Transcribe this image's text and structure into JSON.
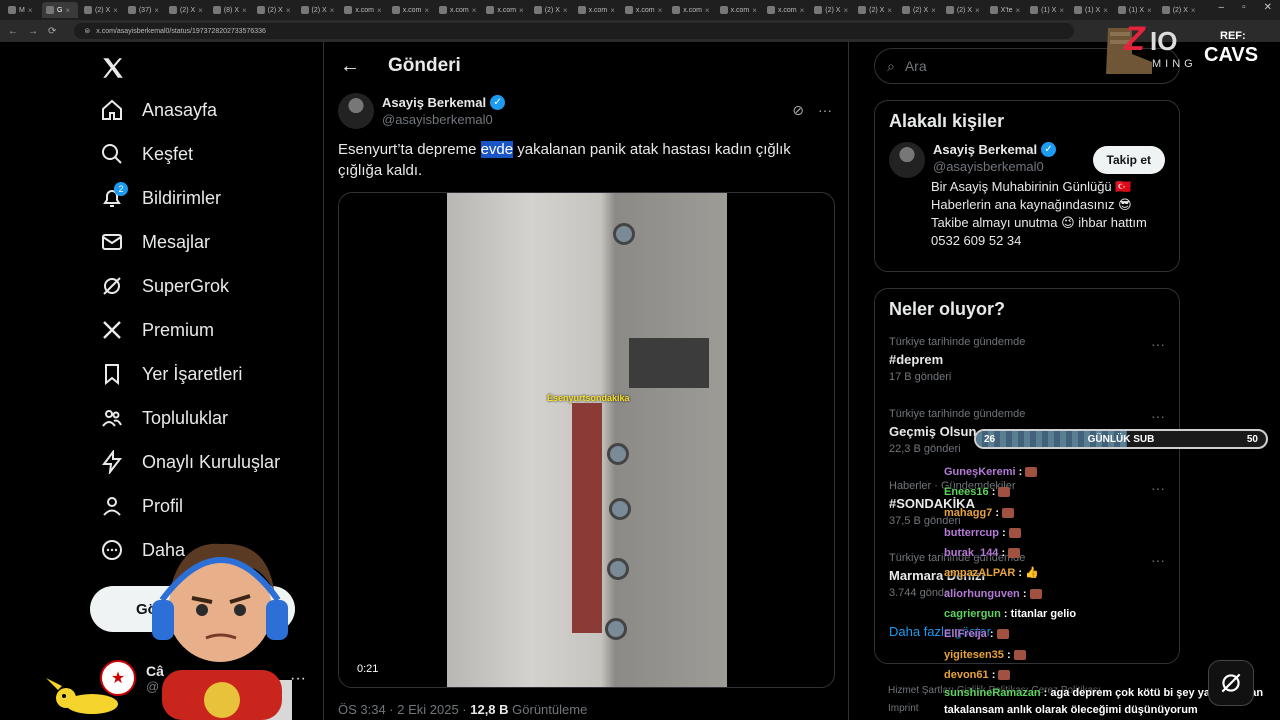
{
  "browser": {
    "tabs": [
      {
        "label": "M",
        "active": false
      },
      {
        "label": "G",
        "active": true
      },
      {
        "label": "(2) X",
        "active": false
      },
      {
        "label": "(37)",
        "active": false
      },
      {
        "label": "(2) X",
        "active": false
      },
      {
        "label": "(8) X",
        "active": false
      },
      {
        "label": "(2) X",
        "active": false
      },
      {
        "label": "(2) X",
        "active": false
      },
      {
        "label": "x.com",
        "active": false
      },
      {
        "label": "x.com",
        "active": false
      },
      {
        "label": "x.com",
        "active": false
      },
      {
        "label": "x.com",
        "active": false
      },
      {
        "label": "(2) X",
        "active": false
      },
      {
        "label": "x.com",
        "active": false
      },
      {
        "label": "x.com",
        "active": false
      },
      {
        "label": "x.com",
        "active": false
      },
      {
        "label": "x.com",
        "active": false
      },
      {
        "label": "x.com",
        "active": false
      },
      {
        "label": "(2) X",
        "active": false
      },
      {
        "label": "(2) X",
        "active": false
      },
      {
        "label": "(2) X",
        "active": false
      },
      {
        "label": "(2) X",
        "active": false
      },
      {
        "label": "X'te",
        "active": false
      },
      {
        "label": "(1) X",
        "active": false
      },
      {
        "label": "(1) X",
        "active": false
      },
      {
        "label": "(1) X",
        "active": false
      },
      {
        "label": "(2) X",
        "active": false
      }
    ],
    "url": "x.com/asayisberkemal0/status/1973728202733576336"
  },
  "sidebar": {
    "items": [
      {
        "label": "Anasayfa",
        "icon": "home-icon"
      },
      {
        "label": "Keşfet",
        "icon": "search-icon"
      },
      {
        "label": "Bildirimler",
        "icon": "bell-icon",
        "badge": "2"
      },
      {
        "label": "Mesajlar",
        "icon": "mail-icon"
      },
      {
        "label": "SuperGrok",
        "icon": "grok-icon"
      },
      {
        "label": "Premium",
        "icon": "x-logo-icon"
      },
      {
        "label": "Yer İşaretleri",
        "icon": "bookmark-icon"
      },
      {
        "label": "Topluluklar",
        "icon": "communities-icon"
      },
      {
        "label": "Onaylı Kuruluşlar",
        "icon": "lightning-icon"
      },
      {
        "label": "Profil",
        "icon": "person-icon"
      },
      {
        "label": "Daha",
        "icon": "more-circle-icon"
      }
    ],
    "post_button": "Gö",
    "account_name": "Câ",
    "account_handle": "@"
  },
  "main": {
    "header_title": "Gönderi",
    "tweet": {
      "author_name": "Asayiş Berkemal",
      "author_handle": "@asayisberkemal0",
      "text_before": "Esenyurt’ta depreme ",
      "text_highlight": "evde",
      "text_after": " yakalanan panik atak hastası kadın çığlık çığlığa kaldı.",
      "video_caption": "Esenyurtsondakika",
      "video_time": "0:21",
      "meta_time": "ÖS 3:34 · 2 Eki 2025 · ",
      "meta_views": "12,8 B",
      "meta_views_label": " Görüntüleme"
    }
  },
  "right": {
    "search_placeholder": "Ara",
    "related_title": "Alakalı kişiler",
    "related_person": {
      "name": "Asayiş Berkemal",
      "handle": "@asayisberkemal0",
      "follow_label": "Takip et",
      "bio": "Bir Asayiş Muhabirinin Günlüğü 🇹🇷 Haberlerin ana kaynağındasınız 😎 Takibe almayı unutma 😉 ihbar hattım 0532 609 52 34"
    },
    "trends_title": "Neler oluyor?",
    "trends": [
      {
        "context": "Türkiye tarihinde gündemde",
        "name": "#deprem",
        "count": "17 B gönderi"
      },
      {
        "context": "Türkiye tarihinde gündemde",
        "name": "Geçmiş Olsun",
        "count": "22,3 B gönderi"
      },
      {
        "context": "Haberler · Gündemdekiler",
        "name": "#SONDAKİKA",
        "count": "37,5 B gönderi"
      },
      {
        "context": "Türkiye tarihinde gündemde",
        "name": "Marmara Denizi",
        "count": "3.744 gönderi"
      }
    ],
    "show_more": "Daha fazla göster",
    "footer_line1": "Hizmet Şartları   Gizlilik Politikası   Çerez Politikası",
    "footer_line2": "Imprint"
  },
  "overlay": {
    "brand_ref": "REF:",
    "brand_cavs": "CAVS",
    "brand_z": "Z",
    "brand_io": "IO",
    "brand_ming": "MING",
    "sub_goal": {
      "label": "GÜNLÜK SUB",
      "current": "26",
      "target": "50",
      "progress": 0.52
    },
    "chat": [
      {
        "user": "GuneşKeremi",
        "color": "#b57ad6",
        "msg": ""
      },
      {
        "user": "Enees16",
        "color": "#5fd35f",
        "msg": ""
      },
      {
        "user": "mahagg7",
        "color": "#e8a33a",
        "msg": ""
      },
      {
        "user": "butterrcup",
        "color": "#b57ad6",
        "msg": ""
      },
      {
        "user": "burak_144",
        "color": "#b57ad6",
        "msg": ""
      },
      {
        "user": "ampazALPAR",
        "color": "#e8a33a",
        "msg": "👍"
      },
      {
        "user": "aliorhunguven",
        "color": "#b57ad6",
        "msg": ""
      },
      {
        "user": "cagriergun",
        "color": "#5fd35f",
        "msg": "titanlar gelio"
      },
      {
        "user": "EllFreija",
        "color": "#b57ad6",
        "msg": ""
      },
      {
        "user": "yigitesen35",
        "color": "#e8a33a",
        "msg": ""
      },
      {
        "user": "devon61",
        "color": "#e8a33a",
        "msg": ""
      },
      {
        "user": "sunshineRamazan",
        "color": "#5fd35f",
        "msg": "aga deprem çok kötü bi şey ya ne zaman takalansam anlık olarak öleceğimi düşünüyorum"
      }
    ]
  },
  "colors": {
    "accent": "#1d9bf0",
    "background": "#000000",
    "border": "#2f3336",
    "muted": "#71767b"
  }
}
